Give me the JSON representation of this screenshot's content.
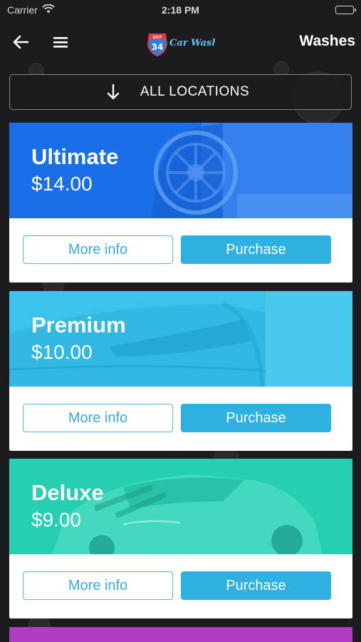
{
  "status_bar": {
    "carrier": "Carrier",
    "time": "2:18 PM"
  },
  "nav": {
    "title": "Washes",
    "logo_text_top": "EXIT",
    "logo_number": "34",
    "logo_text": "Car Wash"
  },
  "location": {
    "label": "ALL LOCATIONS"
  },
  "cards": [
    {
      "name": "Ultimate",
      "price": "$14.00",
      "more_info_label": "More info",
      "purchase_label": "Purchase",
      "color": "#1a6fe8"
    },
    {
      "name": "Premium",
      "price": "$10.00",
      "more_info_label": "More info",
      "purchase_label": "Purchase",
      "color": "#3cc3ea"
    },
    {
      "name": "Deluxe",
      "price": "$9.00",
      "more_info_label": "More info",
      "purchase_label": "Purchase",
      "color": "#25d0b2"
    }
  ],
  "colors": {
    "background": "#1c1c1e",
    "accent": "#2eb1e0",
    "partial_card": "#b23bc4"
  }
}
